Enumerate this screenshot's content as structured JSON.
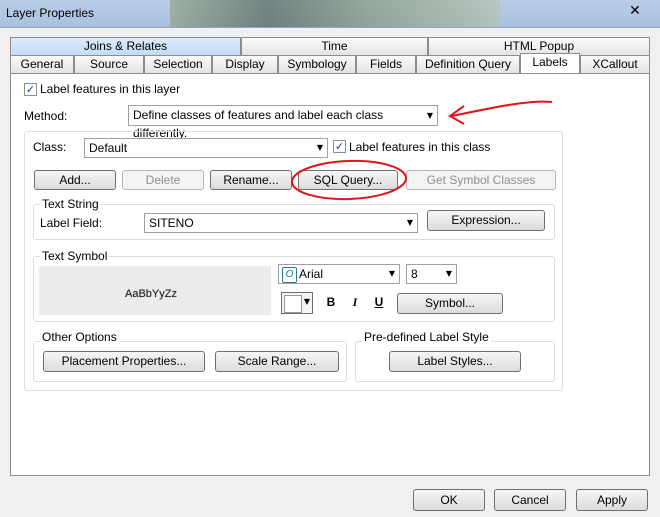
{
  "window": {
    "title": "Layer Properties",
    "close_glyph": "✕"
  },
  "tabs_row1": [
    "Joins & Relates",
    "Time",
    "HTML Popup"
  ],
  "tabs_row2": [
    "General",
    "Source",
    "Selection",
    "Display",
    "Symbology",
    "Fields",
    "Definition Query",
    "Labels",
    "XCallout"
  ],
  "active_tab": "Labels",
  "labels": {
    "label_features_layer": "Label features in this layer",
    "method_label": "Method:",
    "method_value": "Define classes of features and label each class differently.",
    "class_label": "Class:",
    "class_value": "Default",
    "label_features_class": "Label features in this class",
    "add": "Add...",
    "delete": "Delete",
    "rename": "Rename...",
    "sql_query": "SQL Query...",
    "get_symbol_classes": "Get Symbol Classes",
    "text_string": "Text String",
    "label_field": "Label Field:",
    "label_field_value": "SITENO",
    "expression": "Expression...",
    "text_symbol": "Text Symbol",
    "preview_text": "AaBbYyZz",
    "font_value": "Arial",
    "size_value": "8",
    "bold": "B",
    "italic": "I",
    "underline": "U",
    "symbol": "Symbol...",
    "other_options": "Other Options",
    "placement_properties": "Placement Properties...",
    "scale_range": "Scale Range...",
    "predefined_label_style": "Pre-defined Label Style",
    "label_styles": "Label Styles..."
  },
  "footer": {
    "ok": "OK",
    "cancel": "Cancel",
    "apply": "Apply"
  },
  "colors": {
    "annotation_red": "#e0161b",
    "tab_highlight": "#c3dcf5"
  }
}
